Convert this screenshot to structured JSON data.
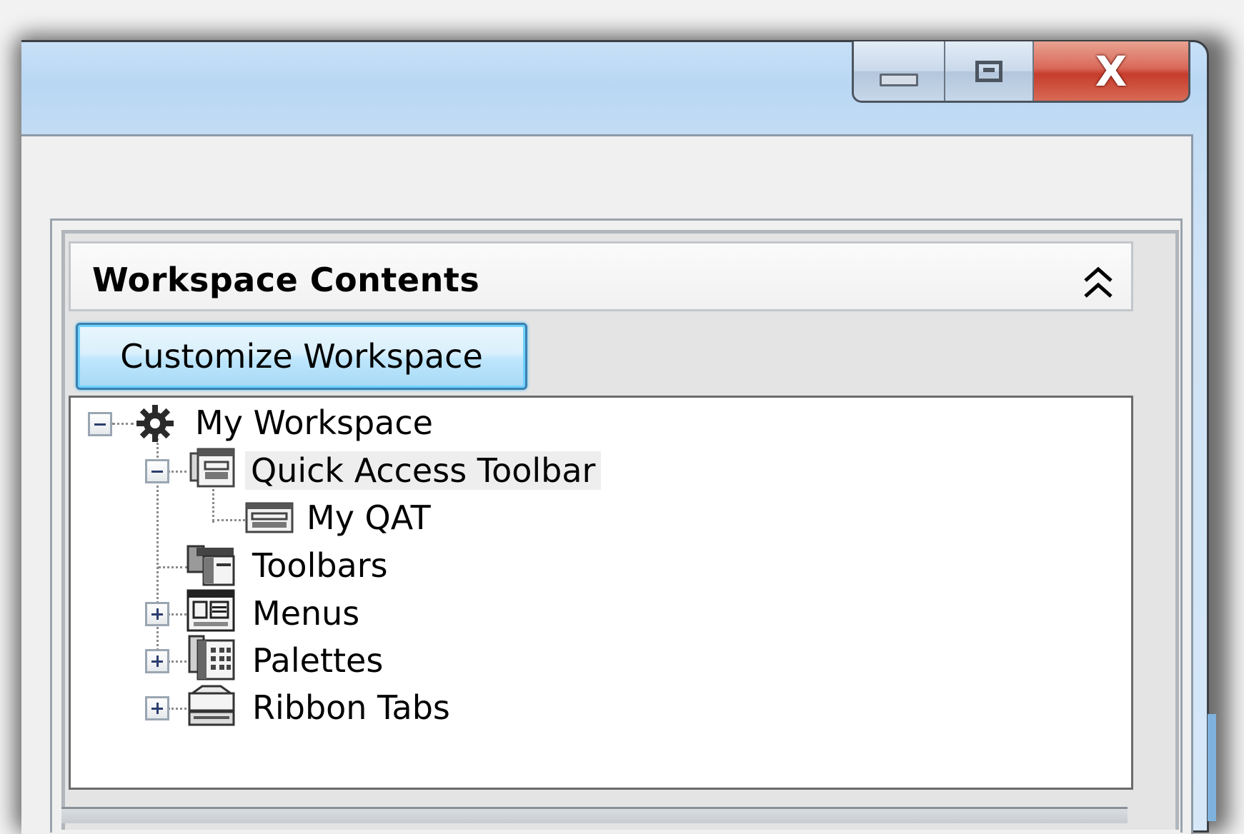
{
  "window": {
    "caption_buttons": {
      "minimize_icon": "minimize-icon",
      "maximize_icon": "maximize-icon",
      "close_glyph": "X"
    }
  },
  "panel": {
    "title": "Workspace Contents",
    "collapse_icon": "double-chevron-up-icon",
    "customize_button_label": "Customize Workspace"
  },
  "tree": {
    "items": [
      {
        "label": "My Workspace",
        "icon": "gear-icon",
        "expander": "collapse",
        "level": 0
      },
      {
        "label": "Quick Access Toolbar",
        "icon": "quick-access-toolbar-icon",
        "expander": "collapse",
        "level": 1,
        "selected": true
      },
      {
        "label": "My QAT",
        "icon": "toolbar-item-icon",
        "expander": "none",
        "level": 2
      },
      {
        "label": "Toolbars",
        "icon": "toolbars-icon",
        "expander": "none",
        "level": 1
      },
      {
        "label": "Menus",
        "icon": "menus-icon",
        "expander": "expand",
        "level": 1
      },
      {
        "label": "Palettes",
        "icon": "palettes-icon",
        "expander": "expand",
        "level": 1
      },
      {
        "label": "Ribbon Tabs",
        "icon": "ribbon-tabs-icon",
        "expander": "expand",
        "level": 1
      }
    ]
  },
  "colors": {
    "titlebar": "#b9d7f4",
    "close_button": "#c63c2c",
    "button_focus": "#3c7fb1"
  }
}
